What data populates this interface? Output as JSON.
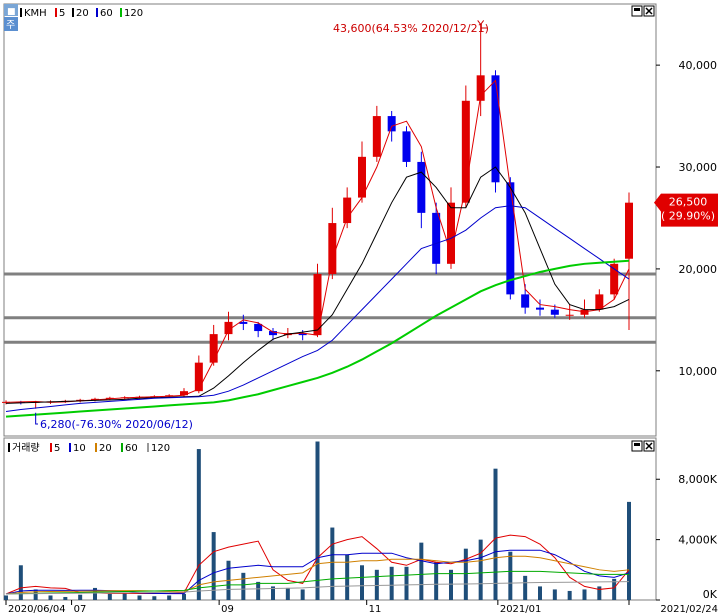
{
  "price_panel": {
    "tag": "주",
    "legend": [
      {
        "text": "KMH",
        "color": "#000000"
      },
      {
        "text": "5",
        "color": "#e00000"
      },
      {
        "text": "20",
        "color": "#000000"
      },
      {
        "text": "60",
        "color": "#0000cc"
      },
      {
        "text": "120",
        "color": "#00bb00"
      }
    ],
    "high_annotation": "43,600(64.53% 2020/12/21)",
    "low_annotation": "6,280(-76.30% 2020/06/12)",
    "last_price": "26,500",
    "last_change": "( 29.90%)"
  },
  "volume_panel": {
    "legend": [
      {
        "text": "거래량",
        "color": "#000000"
      },
      {
        "text": "5",
        "color": "#e00000"
      },
      {
        "text": "10",
        "color": "#0000cc"
      },
      {
        "text": "20",
        "color": "#d08000"
      },
      {
        "text": "60",
        "color": "#00aa00"
      },
      {
        "text": "120",
        "color": "#999999"
      }
    ]
  },
  "x_axis_labels": [
    {
      "text": "2020/06/04",
      "week": 0
    },
    {
      "text": "07",
      "week": 4
    },
    {
      "text": "09",
      "week": 13
    },
    {
      "text": "11",
      "week": 22
    },
    {
      "text": "2021/01",
      "week": 30
    },
    {
      "text": "2021/02/24",
      "week": 38
    }
  ],
  "chart_data": {
    "type": "line",
    "candle_interval": "week",
    "weeks": 38,
    "price_axis": {
      "ticks": [
        10000,
        20000,
        30000,
        40000
      ],
      "tick_labels": [
        "10,000",
        "20,000",
        "30,000",
        "40,000"
      ],
      "ylim": [
        3600,
        46000
      ]
    },
    "price_series": [
      {
        "name": "5",
        "color": "#e00000",
        "values": [
          6900,
          6950,
          6980,
          6900,
          6950,
          7050,
          7150,
          7250,
          7350,
          7400,
          7450,
          7500,
          7600,
          8200,
          11000,
          14000,
          15000,
          14700,
          13800,
          13600,
          13700,
          13500,
          21000,
          25000,
          27000,
          30000,
          34000,
          34500,
          32000,
          26000,
          21500,
          28000,
          37000,
          38500,
          28000,
          18000,
          16500,
          16300,
          16000,
          15800,
          16000,
          17000,
          20000
        ]
      },
      {
        "name": "20",
        "color": "#000000",
        "values": [
          6800,
          6850,
          6900,
          6950,
          7000,
          7050,
          7100,
          7150,
          7200,
          7300,
          7350,
          7400,
          7450,
          7500,
          8300,
          9500,
          10800,
          12000,
          13100,
          13600,
          13800,
          14000,
          15500,
          18000,
          20500,
          23500,
          26500,
          29000,
          29500,
          28000,
          26000,
          26000,
          29000,
          30000,
          28000,
          25500,
          22000,
          18500,
          16500,
          16000,
          16000,
          16300,
          17000
        ]
      },
      {
        "name": "60",
        "color": "#0000cc",
        "values": [
          6000,
          6200,
          6350,
          6500,
          6650,
          6800,
          6900,
          7000,
          7100,
          7200,
          7300,
          7350,
          7400,
          7450,
          7600,
          8000,
          8600,
          9300,
          10000,
          10700,
          11400,
          12000,
          13000,
          14500,
          16000,
          17500,
          19000,
          20500,
          22000,
          22500,
          23000,
          23800,
          25000,
          26000,
          26200,
          26000,
          25000,
          24000,
          23000,
          22000,
          21000,
          20000,
          19000
        ]
      },
      {
        "name": "120",
        "color": "#00cc00",
        "values": [
          5500,
          5600,
          5700,
          5800,
          5900,
          6000,
          6100,
          6200,
          6300,
          6400,
          6500,
          6600,
          6700,
          6800,
          6900,
          7100,
          7400,
          7700,
          8100,
          8500,
          8900,
          9300,
          9800,
          10400,
          11100,
          11900,
          12700,
          13600,
          14500,
          15400,
          16200,
          17000,
          17800,
          18400,
          18900,
          19300,
          19700,
          20000,
          20300,
          20500,
          20600,
          20700,
          20800
        ]
      }
    ],
    "candles": {
      "open": [
        6900,
        6950,
        6900,
        6950,
        7000,
        7050,
        7150,
        7250,
        7350,
        7400,
        7450,
        7500,
        7600,
        8000,
        10800,
        13600,
        14800,
        14600,
        13900,
        13500,
        13700,
        13500,
        19500,
        24500,
        27000,
        31000,
        35000,
        33500,
        30500,
        25500,
        20500,
        26500,
        36500,
        39000,
        28500,
        17500,
        16200,
        16000,
        15500,
        15500,
        16000,
        17500,
        21000
      ],
      "close": [
        6950,
        6900,
        6950,
        7000,
        7050,
        7150,
        7250,
        7350,
        7400,
        7450,
        7500,
        7600,
        8000,
        10800,
        13600,
        14800,
        14600,
        13900,
        13500,
        13700,
        13500,
        19500,
        24500,
        27000,
        31000,
        35000,
        33500,
        30500,
        25500,
        20500,
        26500,
        36500,
        39000,
        28500,
        17500,
        16200,
        16000,
        15500,
        15500,
        16000,
        17500,
        20500,
        26500
      ],
      "high": [
        7100,
        7050,
        7050,
        7100,
        7150,
        7250,
        7350,
        7450,
        7500,
        7550,
        7600,
        7700,
        8300,
        11500,
        14500,
        15800,
        15500,
        14800,
        14200,
        14200,
        14000,
        20500,
        26000,
        28000,
        32500,
        36000,
        35500,
        34000,
        31500,
        26500,
        28000,
        38000,
        43600,
        39500,
        29000,
        18500,
        17000,
        16500,
        16500,
        17000,
        18000,
        21000,
        27500
      ],
      "low": [
        6700,
        6700,
        6280,
        6750,
        6850,
        6900,
        7000,
        7100,
        7200,
        7250,
        7300,
        7350,
        7450,
        7800,
        10500,
        13000,
        14000,
        13300,
        13000,
        13200,
        13000,
        13300,
        19000,
        24000,
        26500,
        30500,
        32500,
        30000,
        24000,
        19500,
        20000,
        26000,
        35000,
        27500,
        17000,
        15600,
        15400,
        15200,
        15000,
        15200,
        15800,
        17000,
        14000
      ]
    },
    "horizontal_levels": [
      19500,
      15200,
      12800
    ],
    "volume_axis": {
      "ticks": [
        0,
        4000,
        8000
      ],
      "tick_labels": [
        "0K",
        "4,000K",
        "8,000K"
      ],
      "ylim": [
        0,
        10600
      ]
    },
    "volume": [
      300,
      2300,
      700,
      300,
      200,
      350,
      800,
      400,
      450,
      300,
      250,
      300,
      400,
      10000,
      4500,
      2600,
      1800,
      1200,
      900,
      800,
      700,
      10500,
      4800,
      3000,
      2300,
      2000,
      2200,
      2200,
      3800,
      2500,
      2000,
      3400,
      4000,
      8700,
      3200,
      1600,
      900,
      700,
      600,
      700,
      900,
      1400,
      6500
    ],
    "volume_series": [
      {
        "name": "5",
        "color": "#e00000",
        "values": [
          400,
          800,
          900,
          800,
          770,
          470,
          470,
          440,
          440,
          430,
          430,
          440,
          480,
          2300,
          3200,
          3500,
          3700,
          3900,
          2000,
          1300,
          1100,
          2800,
          3700,
          4000,
          4200,
          3400,
          2500,
          2300,
          2700,
          2500,
          2400,
          2700,
          3100,
          4100,
          4300,
          4200,
          3700,
          2800,
          1500,
          900,
          700,
          800,
          2000
        ]
      },
      {
        "name": "10",
        "color": "#0000cc",
        "values": [
          400,
          600,
          650,
          650,
          640,
          650,
          650,
          620,
          600,
          470,
          440,
          420,
          420,
          1300,
          1800,
          2100,
          2200,
          2300,
          2200,
          2200,
          2200,
          2800,
          3000,
          3000,
          3100,
          3100,
          3100,
          2800,
          2600,
          2400,
          2500,
          2600,
          2800,
          3200,
          3300,
          3300,
          3300,
          3000,
          2500,
          1900,
          1600,
          1500,
          1800
        ]
      },
      {
        "name": "20",
        "color": "#d08000",
        "values": [
          400,
          500,
          550,
          560,
          570,
          580,
          600,
          610,
          620,
          620,
          600,
          560,
          540,
          1000,
          1200,
          1300,
          1400,
          1500,
          1600,
          1700,
          1800,
          2400,
          2500,
          2500,
          2600,
          2600,
          2700,
          2700,
          2700,
          2600,
          2500,
          2500,
          2600,
          2800,
          2900,
          2900,
          2800,
          2600,
          2400,
          2200,
          2000,
          1900,
          2000
        ]
      },
      {
        "name": "60",
        "color": "#00aa00",
        "values": [
          400,
          420,
          440,
          460,
          480,
          500,
          520,
          540,
          560,
          580,
          600,
          620,
          640,
          800,
          900,
          1000,
          1000,
          1100,
          1100,
          1100,
          1200,
          1300,
          1400,
          1450,
          1500,
          1550,
          1600,
          1650,
          1700,
          1750,
          1750,
          1750,
          1800,
          1850,
          1900,
          1900,
          1900,
          1850,
          1800,
          1750,
          1700,
          1700,
          1700
        ]
      },
      {
        "name": "120",
        "color": "#999999",
        "values": [
          400,
          410,
          420,
          430,
          440,
          450,
          460,
          470,
          480,
          490,
          500,
          510,
          520,
          600,
          650,
          700,
          720,
          740,
          760,
          780,
          800,
          850,
          900,
          920,
          940,
          960,
          980,
          1000,
          1020,
          1040,
          1050,
          1060,
          1080,
          1100,
          1120,
          1140,
          1160,
          1170,
          1180,
          1190,
          1200,
          1210,
          1220
        ]
      }
    ]
  }
}
